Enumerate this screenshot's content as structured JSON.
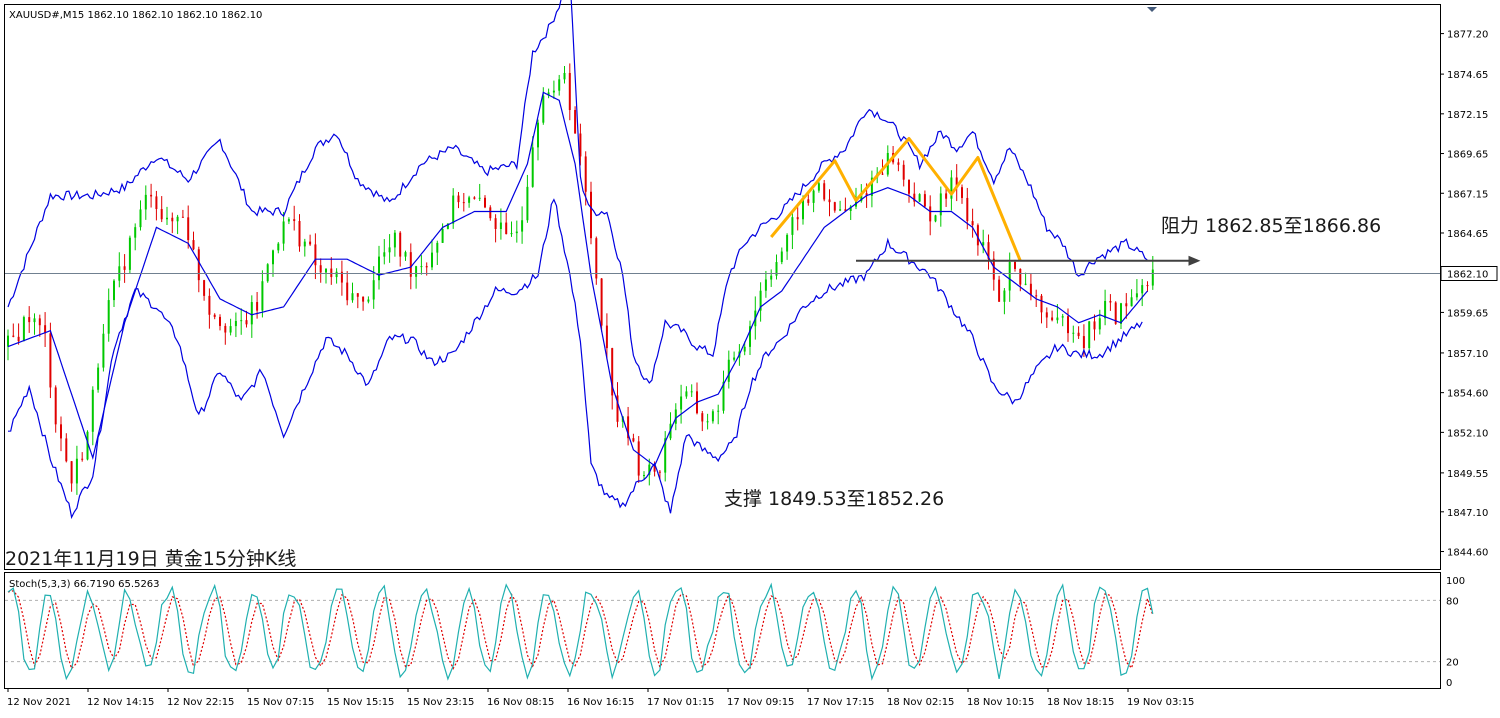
{
  "chart_data": [
    {
      "type": "candlestick",
      "header": "XAUUSD#,M15  1862.10 1862.10 1862.10 1862.10",
      "caption": "2021年11月19日 黄金15分钟K线",
      "ylim": [
        1843.5,
        1879.0
      ],
      "yticks": [
        "1877.20",
        "1874.65",
        "1872.15",
        "1869.65",
        "1867.15",
        "1864.65",
        "1862.10",
        "1859.65",
        "1857.10",
        "1854.60",
        "1852.10",
        "1849.55",
        "1847.10",
        "1844.60"
      ],
      "current_price": 1862.1,
      "current_price_label": "1862.10",
      "xticks": [
        "12 Nov 2021",
        "12 Nov 14:15",
        "12 Nov 22:15",
        "15 Nov 07:15",
        "15 Nov 15:15",
        "15 Nov 23:15",
        "16 Nov 08:15",
        "16 Nov 16:15",
        "17 Nov 01:15",
        "17 Nov 09:15",
        "17 Nov 17:15",
        "18 Nov 02:15",
        "18 Nov 10:15",
        "18 Nov 18:15",
        "19 Nov 03:15"
      ],
      "colors": {
        "bull": "#00c800",
        "bear": "#e00000",
        "band": "#0000e0",
        "zigzag": "#ffb000",
        "arrow": "#404040",
        "price_line": "#708090"
      },
      "price_path": [
        [
          0,
          1857.5
        ],
        [
          4,
          1859.5
        ],
        [
          7,
          1858
        ],
        [
          9,
          1853
        ],
        [
          12,
          1849
        ],
        [
          15,
          1852
        ],
        [
          18,
          1859
        ],
        [
          21,
          1862
        ],
        [
          24,
          1865
        ],
        [
          27,
          1867.5
        ],
        [
          30,
          1865
        ],
        [
          33,
          1866
        ],
        [
          36,
          1862
        ],
        [
          38,
          1860
        ],
        [
          41,
          1859
        ],
        [
          43,
          1858.5
        ],
        [
          47,
          1860
        ],
        [
          50,
          1864
        ],
        [
          53,
          1865.5
        ],
        [
          56,
          1864
        ],
        [
          59,
          1862
        ],
        [
          61,
          1862
        ],
        [
          64,
          1861
        ],
        [
          67,
          1860
        ],
        [
          70,
          1863
        ],
        [
          73,
          1864
        ],
        [
          76,
          1862.5
        ],
        [
          79,
          1863
        ],
        [
          82,
          1865
        ],
        [
          85,
          1867
        ],
        [
          88,
          1866.5
        ],
        [
          91,
          1866
        ],
        [
          94,
          1864
        ],
        [
          97,
          1866
        ],
        [
          99,
          1870.5
        ],
        [
          101,
          1874
        ],
        [
          103,
          1873
        ],
        [
          105,
          1875
        ],
        [
          107,
          1871
        ],
        [
          109,
          1867
        ],
        [
          111,
          1862
        ],
        [
          113,
          1857
        ],
        [
          115,
          1853
        ],
        [
          117,
          1852
        ],
        [
          119,
          1850
        ],
        [
          121,
          1849.5
        ],
        [
          123,
          1850
        ],
        [
          125,
          1853
        ],
        [
          127,
          1854.5
        ],
        [
          129,
          1854
        ],
        [
          131,
          1853
        ],
        [
          133,
          1853
        ],
        [
          135,
          1855
        ],
        [
          137,
          1857
        ],
        [
          139,
          1858
        ],
        [
          141,
          1860
        ],
        [
          143,
          1862
        ],
        [
          145,
          1863
        ],
        [
          147,
          1864
        ],
        [
          149,
          1866
        ],
        [
          151,
          1866.5
        ],
        [
          153,
          1868
        ],
        [
          155,
          1866
        ],
        [
          157,
          1866
        ],
        [
          159,
          1866
        ],
        [
          161,
          1867
        ],
        [
          163,
          1868
        ],
        [
          165,
          1869
        ],
        [
          167,
          1869.5
        ],
        [
          169,
          1868
        ],
        [
          171,
          1867
        ],
        [
          173,
          1866
        ],
        [
          175,
          1866
        ],
        [
          177,
          1867
        ],
        [
          179,
          1868
        ],
        [
          181,
          1866
        ],
        [
          183,
          1864
        ],
        [
          185,
          1863
        ],
        [
          187,
          1860
        ],
        [
          189,
          1863
        ],
        [
          191,
          1861
        ],
        [
          193,
          1861
        ],
        [
          195,
          1860
        ],
        [
          197,
          1858.5
        ],
        [
          199,
          1859
        ],
        [
          201,
          1859
        ],
        [
          203,
          1858
        ],
        [
          205,
          1859
        ],
        [
          207,
          1860
        ],
        [
          209,
          1859.5
        ],
        [
          211,
          1860
        ],
        [
          213,
          1861
        ],
        [
          215,
          1862
        ],
        [
          216,
          1862.1
        ]
      ],
      "bands": {
        "upper": [
          [
            0,
            1860
          ],
          [
            8,
            1867
          ],
          [
            16,
            1867
          ],
          [
            22,
            1867.5
          ],
          [
            28,
            1869.5
          ],
          [
            34,
            1868
          ],
          [
            40,
            1870.5
          ],
          [
            46,
            1866
          ],
          [
            52,
            1866
          ],
          [
            58,
            1870
          ],
          [
            62,
            1871
          ],
          [
            66,
            1868
          ],
          [
            72,
            1866.5
          ],
          [
            78,
            1869
          ],
          [
            84,
            1870
          ],
          [
            90,
            1868.5
          ],
          [
            96,
            1869
          ],
          [
            99,
            1876
          ],
          [
            102,
            1877.5
          ],
          [
            104,
            1879
          ],
          [
            106,
            1881
          ],
          [
            108,
            1868
          ],
          [
            110,
            1866
          ],
          [
            113,
            1866
          ],
          [
            116,
            1862
          ],
          [
            118,
            1857
          ],
          [
            121,
            1855
          ],
          [
            124,
            1859
          ],
          [
            127,
            1858.5
          ],
          [
            130,
            1857.5
          ],
          [
            133,
            1857
          ],
          [
            136,
            1862
          ],
          [
            139,
            1864
          ],
          [
            142,
            1865
          ],
          [
            146,
            1866
          ],
          [
            150,
            1867.5
          ],
          [
            154,
            1869
          ],
          [
            158,
            1870
          ],
          [
            162,
            1872.5
          ],
          [
            165,
            1872
          ],
          [
            168,
            1871
          ],
          [
            172,
            1869
          ],
          [
            176,
            1871
          ],
          [
            179,
            1870
          ],
          [
            182,
            1871
          ],
          [
            186,
            1868
          ],
          [
            189,
            1870
          ],
          [
            193,
            1867.5
          ],
          [
            196,
            1865
          ],
          [
            199,
            1864
          ],
          [
            202,
            1862
          ],
          [
            205,
            1863
          ],
          [
            208,
            1863.5
          ],
          [
            211,
            1864
          ],
          [
            215,
            1863
          ]
        ],
        "middle": [
          [
            0,
            1857.5
          ],
          [
            8,
            1858.5
          ],
          [
            16,
            1850.5
          ],
          [
            22,
            1859
          ],
          [
            28,
            1865
          ],
          [
            34,
            1864
          ],
          [
            40,
            1860.5
          ],
          [
            46,
            1859.5
          ],
          [
            52,
            1860
          ],
          [
            58,
            1863
          ],
          [
            64,
            1863
          ],
          [
            70,
            1862
          ],
          [
            76,
            1862.5
          ],
          [
            82,
            1865
          ],
          [
            88,
            1866
          ],
          [
            94,
            1866
          ],
          [
            98,
            1869
          ],
          [
            101,
            1873.5
          ],
          [
            104,
            1873
          ],
          [
            107,
            1869
          ],
          [
            110,
            1862
          ],
          [
            114,
            1855
          ],
          [
            118,
            1851
          ],
          [
            122,
            1850
          ],
          [
            126,
            1853
          ],
          [
            130,
            1854
          ],
          [
            134,
            1854.5
          ],
          [
            138,
            1857
          ],
          [
            142,
            1860
          ],
          [
            146,
            1861
          ],
          [
            150,
            1863
          ],
          [
            154,
            1865
          ],
          [
            158,
            1866
          ],
          [
            162,
            1867
          ],
          [
            166,
            1867.5
          ],
          [
            170,
            1867
          ],
          [
            174,
            1866
          ],
          [
            178,
            1866
          ],
          [
            182,
            1865
          ],
          [
            186,
            1862.5
          ],
          [
            190,
            1861.5
          ],
          [
            194,
            1860.5
          ],
          [
            198,
            1860
          ],
          [
            202,
            1859
          ],
          [
            206,
            1859.5
          ],
          [
            210,
            1859
          ],
          [
            215,
            1861
          ]
        ],
        "lower": [
          [
            0,
            1852
          ],
          [
            4,
            1855
          ],
          [
            8,
            1850.5
          ],
          [
            12,
            1847
          ],
          [
            16,
            1849.5
          ],
          [
            20,
            1857.5
          ],
          [
            24,
            1861
          ],
          [
            28,
            1860
          ],
          [
            32,
            1858
          ],
          [
            36,
            1853
          ],
          [
            40,
            1856
          ],
          [
            44,
            1854
          ],
          [
            48,
            1856
          ],
          [
            52,
            1852
          ],
          [
            56,
            1855
          ],
          [
            60,
            1858
          ],
          [
            64,
            1857
          ],
          [
            68,
            1855
          ],
          [
            72,
            1858
          ],
          [
            76,
            1858
          ],
          [
            80,
            1856.5
          ],
          [
            84,
            1857
          ],
          [
            88,
            1859
          ],
          [
            92,
            1861
          ],
          [
            96,
            1861
          ],
          [
            100,
            1862
          ],
          [
            103,
            1867
          ],
          [
            106,
            1862
          ],
          [
            108,
            1858
          ],
          [
            110,
            1850
          ],
          [
            113,
            1848
          ],
          [
            116,
            1847.5
          ],
          [
            119,
            1849
          ],
          [
            122,
            1850
          ],
          [
            125,
            1847
          ],
          [
            128,
            1852
          ],
          [
            131,
            1851
          ],
          [
            134,
            1850.5
          ],
          [
            137,
            1851.5
          ],
          [
            140,
            1855
          ],
          [
            143,
            1857
          ],
          [
            146,
            1858
          ],
          [
            150,
            1860
          ],
          [
            154,
            1861
          ],
          [
            158,
            1861.5
          ],
          [
            162,
            1862
          ],
          [
            166,
            1864
          ],
          [
            170,
            1863
          ],
          [
            174,
            1862
          ],
          [
            178,
            1860
          ],
          [
            182,
            1858
          ],
          [
            186,
            1855
          ],
          [
            190,
            1854
          ],
          [
            194,
            1856
          ],
          [
            198,
            1857.5
          ],
          [
            202,
            1857
          ],
          [
            206,
            1857
          ],
          [
            210,
            1858
          ],
          [
            214,
            1859
          ]
        ]
      },
      "zigzag": [
        [
          1849.4,
          1864.5
        ],
        [
          1849.4,
          1864.5
        ]
      ],
      "zigzag_points": [
        [
          144,
          1864.4
        ],
        [
          156,
          1869.2
        ],
        [
          160,
          1866.7
        ],
        [
          170,
          1870.6
        ],
        [
          178,
          1867.1
        ],
        [
          183,
          1869.4
        ],
        [
          191,
          1862.9
        ]
      ],
      "support_resistance_line": {
        "from": 160,
        "to": 225,
        "price": 1862.9
      },
      "annotations": {
        "resistance": "阻力 1862.85至1866.86",
        "support": "支撑 1849.53至1852.26"
      }
    },
    {
      "type": "line",
      "header": "Stoch(5,3,3) 66.7190 65.5263",
      "ylim": [
        0,
        100
      ],
      "yticks": [
        "100",
        "80",
        "20",
        "0"
      ],
      "levels": [
        80,
        20
      ],
      "series": [
        {
          "name": "main",
          "color": "#20b0b0"
        },
        {
          "name": "signal",
          "color": "#e00000"
        }
      ],
      "last_values": [
        66.719,
        65.5263
      ]
    }
  ]
}
